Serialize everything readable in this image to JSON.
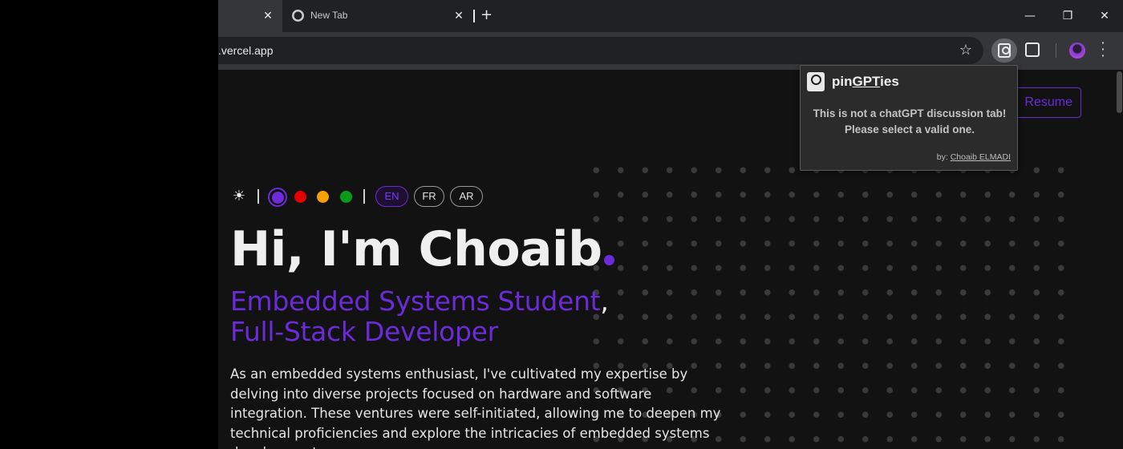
{
  "tabs": [
    {
      "label": ""
    },
    {
      "label": "New Tab"
    }
  ],
  "toolbar": {
    "url": ".vercel.app"
  },
  "page": {
    "resume_label": "Resume",
    "hero_title": "Hi, I'm Choaib",
    "subtitle_line1": "Embedded Systems Student",
    "subtitle_comma": ",",
    "subtitle_line2": "Full-Stack Developer",
    "description": "As an embedded systems enthusiast, I've cultivated my expertise by delving into diverse projects focused on hardware and software integration. These ventures were self-initiated, allowing me to deepen my technical proficiencies and explore the intricacies of embedded systems development.",
    "languages": [
      "EN",
      "FR",
      "AR"
    ],
    "active_language": "EN",
    "theme_colors": [
      "#6b2bd9",
      "#e50000",
      "#f5a000",
      "#0a9a1a"
    ],
    "accent": "#6b2bd9"
  },
  "popup": {
    "title_prefix": "pin",
    "title_underlined": "GPT",
    "title_suffix": "ies",
    "message_line1": "This is not a chatGPT discussion tab!",
    "message_line2": "Please select a valid one.",
    "by_label": "by:",
    "author": "Choaib ELMADI"
  }
}
